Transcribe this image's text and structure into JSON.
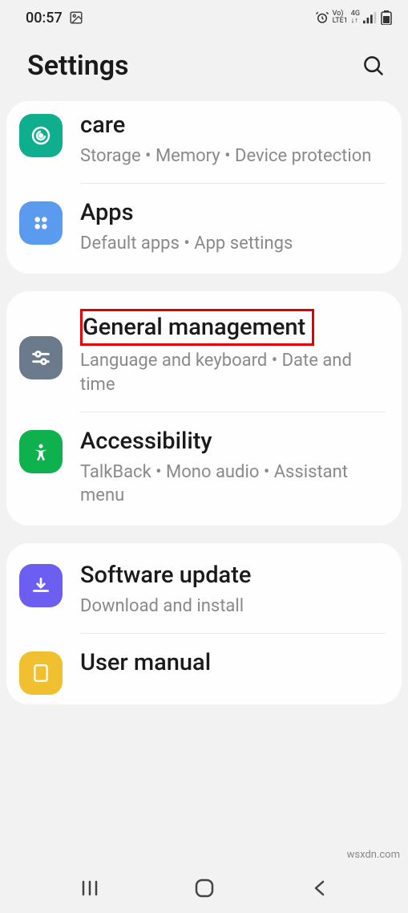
{
  "status": {
    "time": "00:57",
    "lte": "LTE1",
    "volte": "Vo)",
    "net": "4G"
  },
  "header": {
    "title": "Settings"
  },
  "groups": [
    {
      "items": [
        {
          "title": "care",
          "sub": "Storage  •  Memory  •  Device protection"
        },
        {
          "title": "Apps",
          "sub": "Default apps  •  App settings"
        }
      ]
    },
    {
      "items": [
        {
          "title": "General management",
          "sub": "Language and keyboard  •  Date and time"
        },
        {
          "title": "Accessibility",
          "sub": "TalkBack  •  Mono audio  •  Assistant menu"
        }
      ]
    },
    {
      "items": [
        {
          "title": "Software update",
          "sub": "Download and install"
        },
        {
          "title": "User manual",
          "sub": ""
        }
      ]
    }
  ],
  "watermark": "wsxdn.com"
}
